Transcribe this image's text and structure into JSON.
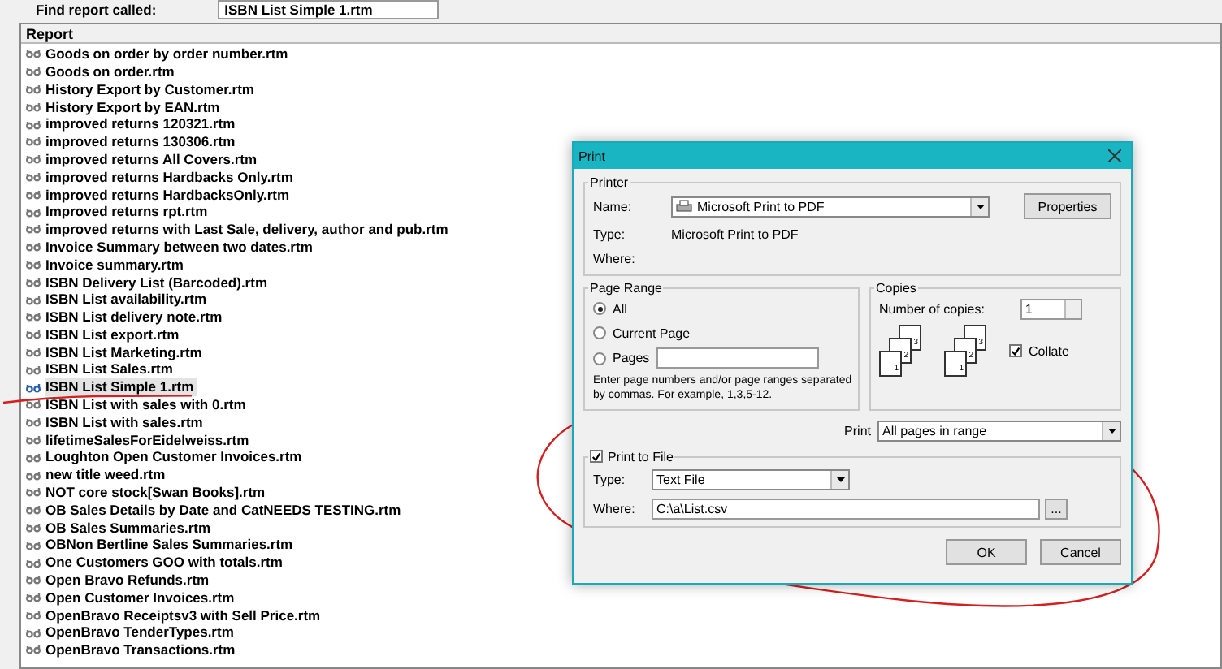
{
  "find_bar": {
    "label": "Find report called:",
    "value": "ISBN List Simple 1.rtm"
  },
  "report_list": {
    "header": "Report",
    "rows": [
      {
        "name": "Goods on order by order number.rtm",
        "selected": false
      },
      {
        "name": "Goods on order.rtm",
        "selected": false
      },
      {
        "name": "History Export by Customer.rtm",
        "selected": false
      },
      {
        "name": "History Export by EAN.rtm",
        "selected": false
      },
      {
        "name": "improved returns 120321.rtm",
        "selected": false
      },
      {
        "name": "improved returns 130306.rtm",
        "selected": false
      },
      {
        "name": "improved returns All Covers.rtm",
        "selected": false
      },
      {
        "name": "improved returns Hardbacks Only.rtm",
        "selected": false
      },
      {
        "name": "improved returns HardbacksOnly.rtm",
        "selected": false
      },
      {
        "name": "Improved returns rpt.rtm",
        "selected": false
      },
      {
        "name": "improved returns with Last Sale, delivery, author and pub.rtm",
        "selected": false
      },
      {
        "name": "Invoice Summary between two dates.rtm",
        "selected": false
      },
      {
        "name": "Invoice summary.rtm",
        "selected": false
      },
      {
        "name": "ISBN Delivery List (Barcoded).rtm",
        "selected": false
      },
      {
        "name": "ISBN List availability.rtm",
        "selected": false
      },
      {
        "name": "ISBN List delivery note.rtm",
        "selected": false
      },
      {
        "name": "ISBN List export.rtm",
        "selected": false
      },
      {
        "name": "ISBN List Marketing.rtm",
        "selected": false
      },
      {
        "name": "ISBN List Sales.rtm",
        "selected": false
      },
      {
        "name": "ISBN List Simple 1.rtm",
        "selected": true
      },
      {
        "name": "ISBN List with sales with 0.rtm",
        "selected": false
      },
      {
        "name": "ISBN List with sales.rtm",
        "selected": false
      },
      {
        "name": "lifetimeSalesForEidelweiss.rtm",
        "selected": false
      },
      {
        "name": "Loughton Open Customer Invoices.rtm",
        "selected": false
      },
      {
        "name": "new title weed.rtm",
        "selected": false
      },
      {
        "name": "NOT core stock[Swan Books].rtm",
        "selected": false
      },
      {
        "name": "OB Sales Details by Date and CatNEEDS TESTING.rtm",
        "selected": false
      },
      {
        "name": "OB Sales Summaries.rtm",
        "selected": false
      },
      {
        "name": "OBNon Bertline Sales Summaries.rtm",
        "selected": false
      },
      {
        "name": "One Customers GOO with totals.rtm",
        "selected": false
      },
      {
        "name": "Open Bravo Refunds.rtm",
        "selected": false
      },
      {
        "name": "Open Customer Invoices.rtm",
        "selected": false
      },
      {
        "name": "OpenBravo Receiptsv3 with Sell Price.rtm",
        "selected": false
      },
      {
        "name": "OpenBravo TenderTypes.rtm",
        "selected": false
      },
      {
        "name": "OpenBravo Transactions.rtm",
        "selected": false
      }
    ]
  },
  "dialog": {
    "title": "Print",
    "printer": {
      "legend": "Printer",
      "name_label": "Name:",
      "name_value": "Microsoft Print to PDF",
      "properties_button": "Properties",
      "type_label": "Type:",
      "type_value": "Microsoft Print to PDF",
      "where_label": "Where:"
    },
    "page_range": {
      "legend": "Page Range",
      "options": [
        {
          "label": "All",
          "selected": true
        },
        {
          "label": "Current Page",
          "selected": false
        },
        {
          "label": "Pages",
          "selected": false
        }
      ],
      "hint": "Enter page numbers and/or page ranges separated by commas.  For example, 1,3,5-12."
    },
    "copies": {
      "legend": "Copies",
      "count_label": "Number of copies:",
      "count_value": "1",
      "stacks": [
        {
          "pages": [
            "3",
            "2",
            "1"
          ]
        },
        {
          "pages": [
            "3",
            "2",
            "1"
          ]
        }
      ],
      "collate": {
        "label": "Collate",
        "checked": true
      }
    },
    "print_label": "Print",
    "print_value": "All pages in range",
    "print_to_file": {
      "label": "Print to File",
      "checked": true,
      "type_label": "Type:",
      "type_value": "Text File",
      "where_label": "Where:",
      "where_value": "C:\\a\\List.csv",
      "browse_button": "..."
    },
    "buttons": [
      "OK",
      "Cancel"
    ]
  }
}
